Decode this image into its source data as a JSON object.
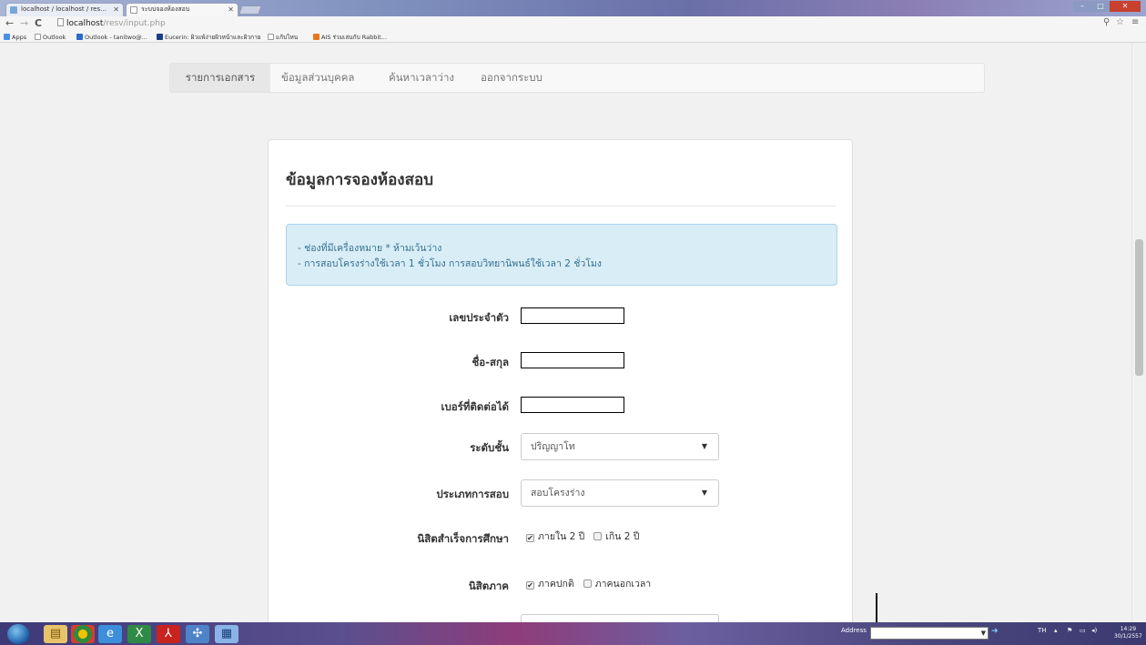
{
  "browser": {
    "tabs": [
      {
        "label": "localhost / localhost / res..."
      },
      {
        "label": "ระบบจองห้องสอบ"
      }
    ],
    "url_host": "localhost",
    "url_path": "/resv/input.php",
    "bookmarks": [
      {
        "label": "Apps",
        "color": "#4a90e2"
      },
      {
        "label": "Outlook",
        "color": "#ffffff"
      },
      {
        "label": "Outlook - tanitwo@...",
        "color": "#2b6cc4"
      },
      {
        "label": "Eucerin: ผิวแพ้ง่ายผิวหน้าและผิวกาย",
        "color": "#1a3f8a"
      },
      {
        "label": "แก้บไหน",
        "color": "#ffffff"
      },
      {
        "label": "AIS ร่วมเล่นกับ Rabbit...",
        "color": "#e87722"
      }
    ]
  },
  "nav": {
    "items": [
      {
        "label": "รายการเอกสาร",
        "active": true
      },
      {
        "label": "ข้อมูลส่วนบุคคล",
        "active": false
      },
      {
        "label": "ค้นหาเวลาว่าง",
        "active": false
      },
      {
        "label": "ออกจากระบบ",
        "active": false
      }
    ]
  },
  "form": {
    "title": "ข้อมูลการจองห้องสอบ",
    "notice_line1": "- ช่องที่มีเครื่องหมาย * ห้ามเว้นว่าง",
    "notice_line2": "- การสอบโครงร่างใช้เวลา 1 ชั่วโมง การสอบวิทยานิพนธ์ใช้เวลา 2 ชั่วโมง",
    "student_id_label": "เลขประจำตัว",
    "student_id_value": "",
    "name_label": "ชื่อ-สกุล",
    "name_value": "",
    "phone_label": "เบอร์ที่ติดต่อได้",
    "phone_value": "",
    "level_label": "ระดับชั้น",
    "level_selected": "ปริญญาโท",
    "exam_type_label": "ประเภทการสอบ",
    "exam_type_selected": "สอบโครงร่าง",
    "graduation_label": "นิสิตสำเร็จการศึกษา",
    "graduation_options": [
      {
        "label": "ภายใน 2 ปี",
        "checked": true
      },
      {
        "label": "เกิน 2 ปี",
        "checked": false
      }
    ],
    "program_label": "นิสิตภาค",
    "program_options": [
      {
        "label": "ภาคปกติ",
        "checked": true
      },
      {
        "label": "ภาคนอกเวลา",
        "checked": false
      }
    ]
  },
  "taskbar": {
    "address_label": "Address",
    "lang": "TH",
    "time": "14:29",
    "date": "30/1/2557"
  },
  "colors": {
    "alert_bg": "#d9edf7",
    "alert_text": "#31708f",
    "navbar_bg": "#f8f8f8"
  }
}
